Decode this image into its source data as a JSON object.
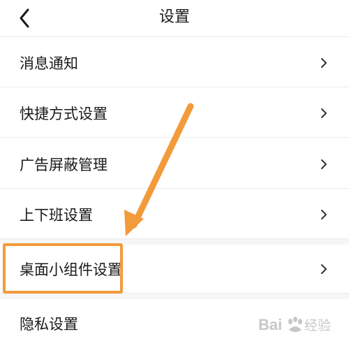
{
  "header": {
    "title": "设置",
    "back_icon": "chevron-left-icon"
  },
  "settings": {
    "items": [
      {
        "label": "消息通知"
      },
      {
        "label": "快捷方式设置"
      },
      {
        "label": "广告屏蔽管理"
      },
      {
        "label": "上下班设置"
      },
      {
        "label": "桌面小组件设置"
      },
      {
        "label": "隐私设置"
      }
    ],
    "row_icon": "chevron-right-icon"
  },
  "annotation": {
    "color": "#f39a3b",
    "icon": "arrow-down-left-icon",
    "highlighted_item": "桌面小组件设置"
  },
  "watermark": {
    "text": "Baidu 经验"
  }
}
